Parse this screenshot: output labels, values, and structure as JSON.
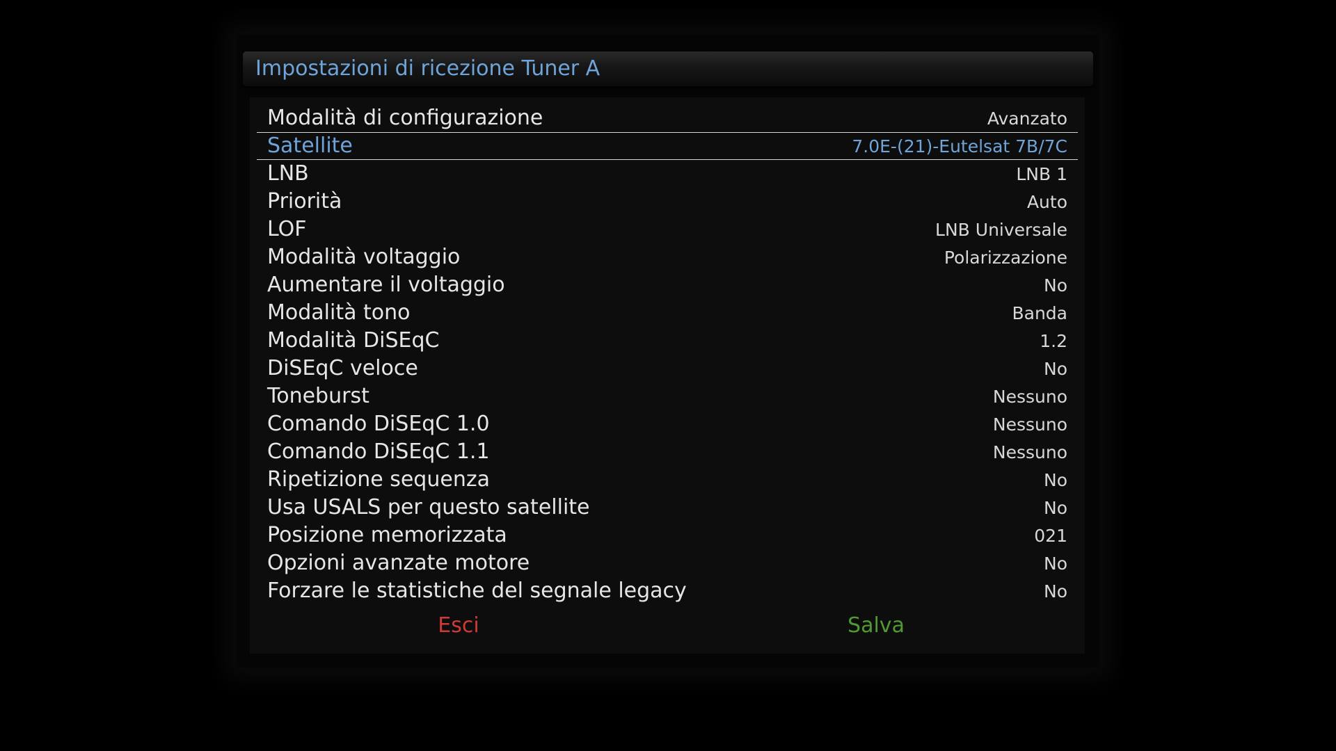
{
  "colors": {
    "title": "#6fa4d8",
    "label": "#e6e6e6",
    "value": "#d8d8d8",
    "selected": "#6fa4d8",
    "exit": "#d03a36",
    "save": "#4f9a32"
  },
  "header": {
    "title": "Impostazioni di ricezione Tuner A"
  },
  "settings": [
    {
      "label": "Modalità di configurazione",
      "value": "Avanzato"
    },
    {
      "label": "Satellite",
      "value": "7.0E-(21)-Eutelsat 7B/7C"
    },
    {
      "label": "LNB",
      "value": "LNB 1"
    },
    {
      "label": "Priorità",
      "value": "Auto"
    },
    {
      "label": "LOF",
      "value": "LNB Universale"
    },
    {
      "label": "Modalità voltaggio",
      "value": "Polarizzazione"
    },
    {
      "label": "Aumentare il voltaggio",
      "value": "No"
    },
    {
      "label": "Modalità tono",
      "value": "Banda"
    },
    {
      "label": "Modalità DiSEqC",
      "value": "1.2"
    },
    {
      "label": "DiSEqC veloce",
      "value": "No"
    },
    {
      "label": "Toneburst",
      "value": "Nessuno"
    },
    {
      "label": "Comando DiSEqC 1.0",
      "value": "Nessuno"
    },
    {
      "label": "Comando DiSEqC 1.1",
      "value": "Nessuno"
    },
    {
      "label": "Ripetizione sequenza",
      "value": "No"
    },
    {
      "label": "Usa USALS per questo satellite",
      "value": "No"
    },
    {
      "label": "Posizione memorizzata",
      "value": "021"
    },
    {
      "label": "Opzioni avanzate motore",
      "value": "No"
    },
    {
      "label": "Forzare le statistiche del segnale legacy",
      "value": "No"
    }
  ],
  "footer": {
    "exit_label": "Esci",
    "save_label": "Salva"
  }
}
